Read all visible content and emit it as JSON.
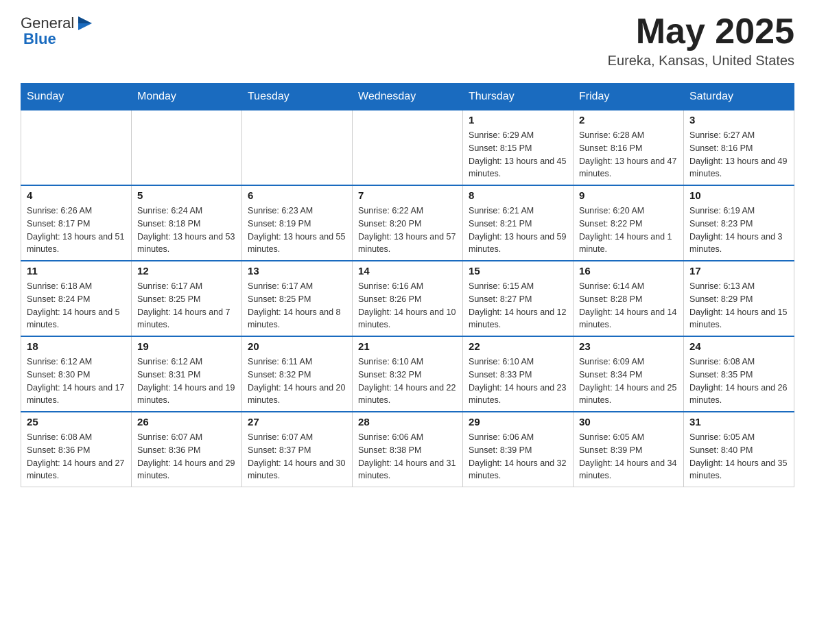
{
  "header": {
    "logo_text_general": "General",
    "logo_text_blue": "Blue",
    "month_year": "May 2025",
    "location": "Eureka, Kansas, United States"
  },
  "days_of_week": [
    "Sunday",
    "Monday",
    "Tuesday",
    "Wednesday",
    "Thursday",
    "Friday",
    "Saturday"
  ],
  "weeks": [
    [
      {
        "day": "",
        "info": ""
      },
      {
        "day": "",
        "info": ""
      },
      {
        "day": "",
        "info": ""
      },
      {
        "day": "",
        "info": ""
      },
      {
        "day": "1",
        "info": "Sunrise: 6:29 AM\nSunset: 8:15 PM\nDaylight: 13 hours and 45 minutes."
      },
      {
        "day": "2",
        "info": "Sunrise: 6:28 AM\nSunset: 8:16 PM\nDaylight: 13 hours and 47 minutes."
      },
      {
        "day": "3",
        "info": "Sunrise: 6:27 AM\nSunset: 8:16 PM\nDaylight: 13 hours and 49 minutes."
      }
    ],
    [
      {
        "day": "4",
        "info": "Sunrise: 6:26 AM\nSunset: 8:17 PM\nDaylight: 13 hours and 51 minutes."
      },
      {
        "day": "5",
        "info": "Sunrise: 6:24 AM\nSunset: 8:18 PM\nDaylight: 13 hours and 53 minutes."
      },
      {
        "day": "6",
        "info": "Sunrise: 6:23 AM\nSunset: 8:19 PM\nDaylight: 13 hours and 55 minutes."
      },
      {
        "day": "7",
        "info": "Sunrise: 6:22 AM\nSunset: 8:20 PM\nDaylight: 13 hours and 57 minutes."
      },
      {
        "day": "8",
        "info": "Sunrise: 6:21 AM\nSunset: 8:21 PM\nDaylight: 13 hours and 59 minutes."
      },
      {
        "day": "9",
        "info": "Sunrise: 6:20 AM\nSunset: 8:22 PM\nDaylight: 14 hours and 1 minute."
      },
      {
        "day": "10",
        "info": "Sunrise: 6:19 AM\nSunset: 8:23 PM\nDaylight: 14 hours and 3 minutes."
      }
    ],
    [
      {
        "day": "11",
        "info": "Sunrise: 6:18 AM\nSunset: 8:24 PM\nDaylight: 14 hours and 5 minutes."
      },
      {
        "day": "12",
        "info": "Sunrise: 6:17 AM\nSunset: 8:25 PM\nDaylight: 14 hours and 7 minutes."
      },
      {
        "day": "13",
        "info": "Sunrise: 6:17 AM\nSunset: 8:25 PM\nDaylight: 14 hours and 8 minutes."
      },
      {
        "day": "14",
        "info": "Sunrise: 6:16 AM\nSunset: 8:26 PM\nDaylight: 14 hours and 10 minutes."
      },
      {
        "day": "15",
        "info": "Sunrise: 6:15 AM\nSunset: 8:27 PM\nDaylight: 14 hours and 12 minutes."
      },
      {
        "day": "16",
        "info": "Sunrise: 6:14 AM\nSunset: 8:28 PM\nDaylight: 14 hours and 14 minutes."
      },
      {
        "day": "17",
        "info": "Sunrise: 6:13 AM\nSunset: 8:29 PM\nDaylight: 14 hours and 15 minutes."
      }
    ],
    [
      {
        "day": "18",
        "info": "Sunrise: 6:12 AM\nSunset: 8:30 PM\nDaylight: 14 hours and 17 minutes."
      },
      {
        "day": "19",
        "info": "Sunrise: 6:12 AM\nSunset: 8:31 PM\nDaylight: 14 hours and 19 minutes."
      },
      {
        "day": "20",
        "info": "Sunrise: 6:11 AM\nSunset: 8:32 PM\nDaylight: 14 hours and 20 minutes."
      },
      {
        "day": "21",
        "info": "Sunrise: 6:10 AM\nSunset: 8:32 PM\nDaylight: 14 hours and 22 minutes."
      },
      {
        "day": "22",
        "info": "Sunrise: 6:10 AM\nSunset: 8:33 PM\nDaylight: 14 hours and 23 minutes."
      },
      {
        "day": "23",
        "info": "Sunrise: 6:09 AM\nSunset: 8:34 PM\nDaylight: 14 hours and 25 minutes."
      },
      {
        "day": "24",
        "info": "Sunrise: 6:08 AM\nSunset: 8:35 PM\nDaylight: 14 hours and 26 minutes."
      }
    ],
    [
      {
        "day": "25",
        "info": "Sunrise: 6:08 AM\nSunset: 8:36 PM\nDaylight: 14 hours and 27 minutes."
      },
      {
        "day": "26",
        "info": "Sunrise: 6:07 AM\nSunset: 8:36 PM\nDaylight: 14 hours and 29 minutes."
      },
      {
        "day": "27",
        "info": "Sunrise: 6:07 AM\nSunset: 8:37 PM\nDaylight: 14 hours and 30 minutes."
      },
      {
        "day": "28",
        "info": "Sunrise: 6:06 AM\nSunset: 8:38 PM\nDaylight: 14 hours and 31 minutes."
      },
      {
        "day": "29",
        "info": "Sunrise: 6:06 AM\nSunset: 8:39 PM\nDaylight: 14 hours and 32 minutes."
      },
      {
        "day": "30",
        "info": "Sunrise: 6:05 AM\nSunset: 8:39 PM\nDaylight: 14 hours and 34 minutes."
      },
      {
        "day": "31",
        "info": "Sunrise: 6:05 AM\nSunset: 8:40 PM\nDaylight: 14 hours and 35 minutes."
      }
    ]
  ]
}
